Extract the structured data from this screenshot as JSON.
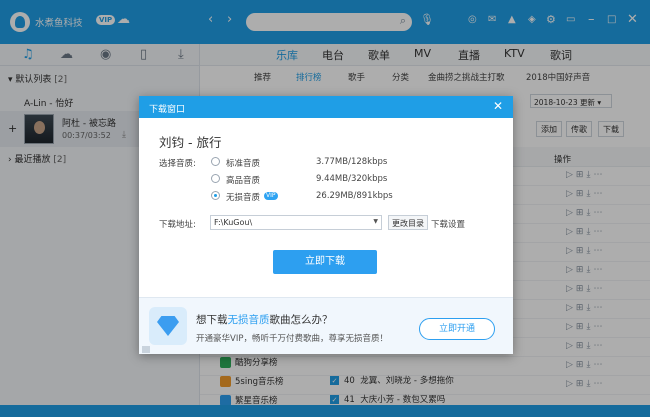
{
  "app": {
    "username": "水煮鱼科技",
    "vip": "VIP"
  },
  "sidebar": {
    "section1": "默认列表",
    "section1_count": "[2]",
    "artist_row": "A-Lin - 怡好",
    "now_song": "阿杜 - 被忘路",
    "now_time": "00:37/03:52",
    "section2": "最近播放",
    "section2_count": "[2]"
  },
  "nav": {
    "main_tabs": [
      "乐库",
      "电台",
      "歌单",
      "MV",
      "直播",
      "KTV",
      "歌词"
    ],
    "sub_tabs": [
      "推荐",
      "排行榜",
      "歌手",
      "分类",
      "金曲捞之挑战主打歌",
      "2018中国好声音"
    ]
  },
  "list": {
    "date": "2018-10-23 更新",
    "actions": [
      "添加",
      "传歌",
      "下载"
    ],
    "op_header": "操作",
    "ranks": [
      "酷狗分享榜",
      "5sing音乐榜",
      "繁星音乐榜"
    ],
    "bottom_rows": [
      {
        "num": "40",
        "title": "龙翼、刘晓龙 - 多想拖你"
      },
      {
        "num": "41",
        "title": "大庆小芳 - 数包又累吗"
      }
    ]
  },
  "dialog": {
    "title": "下载窗口",
    "song": "刘钧 - 旅行",
    "quality_label": "选择音质:",
    "options": [
      {
        "name": "标准音质",
        "size": "3.77MB/128kbps"
      },
      {
        "name": "高品音质",
        "size": "9.44MB/320kbps"
      },
      {
        "name": "无损音质",
        "size": "26.29MB/891kbps"
      }
    ],
    "vip_tag": "VIP",
    "dir_label": "下载地址:",
    "dir_value": "F:\\KuGou\\",
    "change_dir": "更改目录",
    "settings": "下载设置",
    "download_button": "立即下载",
    "promo_title_pre": "想下载",
    "promo_title_hl": "无损音质",
    "promo_title_post": "歌曲怎么办？",
    "promo_sub": "开通豪华VIP，畅听千万付费歌曲，尊享无损音质！",
    "open_button": "立即开通"
  }
}
